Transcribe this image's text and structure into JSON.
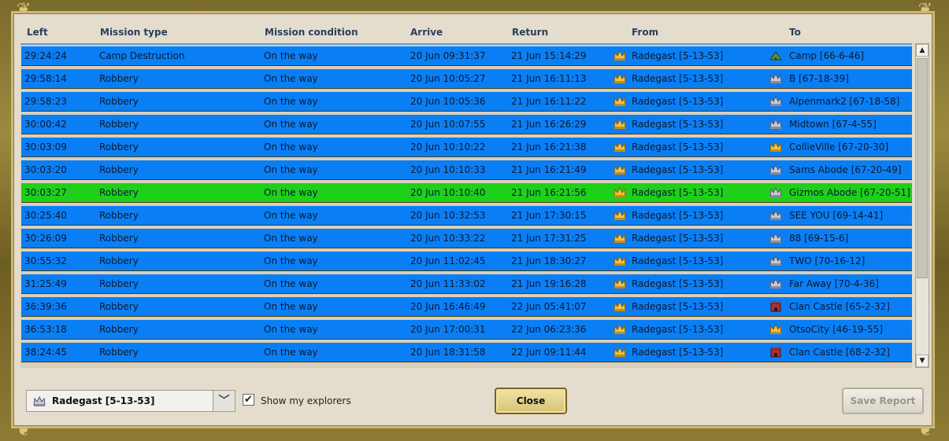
{
  "columns": {
    "left": "Left",
    "mission_type": "Mission type",
    "mission_condition": "Mission condition",
    "arrive": "Arrive",
    "return": "Return",
    "from": "From",
    "to": "To"
  },
  "rows": [
    {
      "left": "29:24:24",
      "type": "Camp Destruction",
      "condition": "On the way",
      "arrive": "20 Jun 09:31:37",
      "return": "21 Jun 15:14:29",
      "from": "Radegast [5-13-53]",
      "to": "Camp [66-6-46]",
      "to_icon": "camp-icon"
    },
    {
      "left": "29:58:14",
      "type": "Robbery",
      "condition": "On the way",
      "arrive": "20 Jun 10:05:27",
      "return": "21 Jun 16:11:13",
      "from": "Radegast [5-13-53]",
      "to": "B [67-18-39]",
      "to_icon": "silver-crown-icon"
    },
    {
      "left": "29:58:23",
      "type": "Robbery",
      "condition": "On the way",
      "arrive": "20 Jun 10:05:36",
      "return": "21 Jun 16:11:22",
      "from": "Radegast [5-13-53]",
      "to": "Alpenmark2 [67-18-58]",
      "to_icon": "silver-crown-icon"
    },
    {
      "left": "30:00:42",
      "type": "Robbery",
      "condition": "On the way",
      "arrive": "20 Jun 10:07:55",
      "return": "21 Jun 16:26:29",
      "from": "Radegast [5-13-53]",
      "to": "Midtown [67-4-55]",
      "to_icon": "silver-crown-icon"
    },
    {
      "left": "30:03:09",
      "type": "Robbery",
      "condition": "On the way",
      "arrive": "20 Jun 10:10:22",
      "return": "21 Jun 16:21:38",
      "from": "Radegast [5-13-53]",
      "to": "CollieVille [67-20-30]",
      "to_icon": "gold-crown-icon"
    },
    {
      "left": "30:03:20",
      "type": "Robbery",
      "condition": "On the way",
      "arrive": "20 Jun 10:10:33",
      "return": "21 Jun 16:21:49",
      "from": "Radegast [5-13-53]",
      "to": "Sams Abode [67-20-49]",
      "to_icon": "silver-crown-icon"
    },
    {
      "left": "30:03:27",
      "type": "Robbery",
      "condition": "On the way",
      "arrive": "20 Jun 10:10:40",
      "return": "21 Jun 16:21:56",
      "from": "Radegast [5-13-53]",
      "to": "Gizmos Abode [67-20-51]",
      "to_icon": "silver-crown-icon",
      "selected": true
    },
    {
      "left": "30:25:40",
      "type": "Robbery",
      "condition": "On the way",
      "arrive": "20 Jun 10:32:53",
      "return": "21 Jun 17:30:15",
      "from": "Radegast [5-13-53]",
      "to": "SEE YOU [69-14-41]",
      "to_icon": "silver-crown-icon"
    },
    {
      "left": "30:26:09",
      "type": "Robbery",
      "condition": "On the way",
      "arrive": "20 Jun 10:33:22",
      "return": "21 Jun 17:31:25",
      "from": "Radegast [5-13-53]",
      "to": "88 [69-15-6]",
      "to_icon": "silver-crown-icon"
    },
    {
      "left": "30:55:32",
      "type": "Robbery",
      "condition": "On the way",
      "arrive": "20 Jun 11:02:45",
      "return": "21 Jun 18:30:27",
      "from": "Radegast [5-13-53]",
      "to": "TWO [70-16-12]",
      "to_icon": "silver-crown-icon"
    },
    {
      "left": "31:25:49",
      "type": "Robbery",
      "condition": "On the way",
      "arrive": "20 Jun 11:33:02",
      "return": "21 Jun 19:16:28",
      "from": "Radegast [5-13-53]",
      "to": "Far Away [70-4-36]",
      "to_icon": "silver-crown-icon"
    },
    {
      "left": "36:39:36",
      "type": "Robbery",
      "condition": "On the way",
      "arrive": "20 Jun 16:46:49",
      "return": "22 Jun 05:41:07",
      "from": "Radegast [5-13-53]",
      "to": "Clan Castle [65-2-32]",
      "to_icon": "castle-icon"
    },
    {
      "left": "36:53:18",
      "type": "Robbery",
      "condition": "On the way",
      "arrive": "20 Jun 17:00:31",
      "return": "22 Jun 06:23:36",
      "from": "Radegast [5-13-53]",
      "to": "OtsoCity [46-19-55]",
      "to_icon": "gold-crown-icon"
    },
    {
      "left": "38:24:45",
      "type": "Robbery",
      "condition": "On the way",
      "arrive": "20 Jun 18:31:58",
      "return": "22 Jun 09:11:44",
      "from": "Radegast [5-13-53]",
      "to": "Clan Castle [68-2-32]",
      "to_icon": "castle-icon"
    }
  ],
  "footer": {
    "dropdown_value": "Radegast [5-13-53]",
    "show_explorers_label": "Show my explorers",
    "show_explorers_checked": true,
    "close_label": "Close",
    "save_report_label": "Save Report"
  },
  "colors": {
    "row_bg": "#0a7ff5",
    "row_selected_bg": "#1ed01a",
    "panel_bg": "#e4ddcd"
  }
}
